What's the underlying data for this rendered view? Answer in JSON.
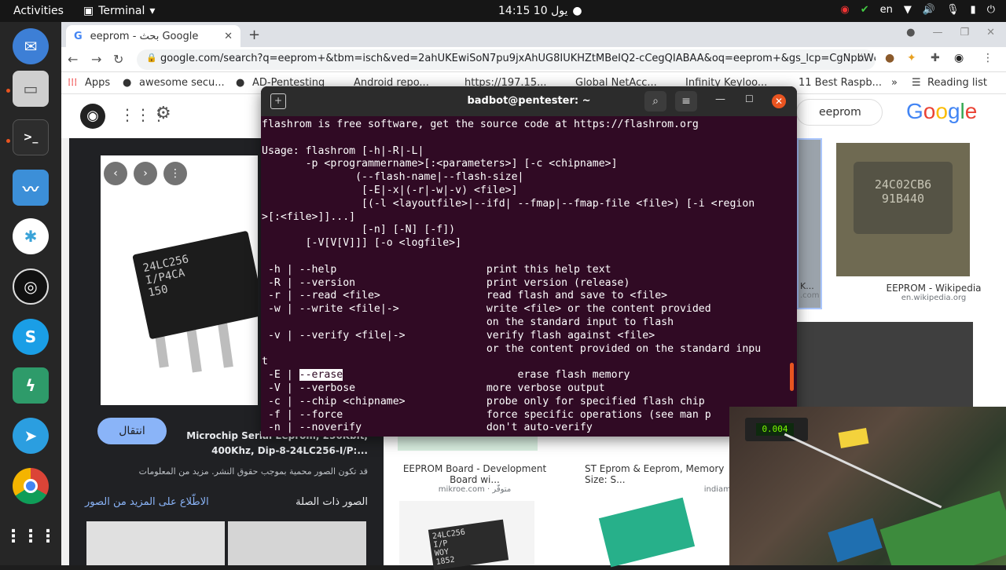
{
  "topbar": {
    "activities": "Activities",
    "app_name": "Terminal",
    "clock": "14:15  يول 10",
    "language": "en"
  },
  "browser": {
    "tab_title": "eeprom - بحث Google",
    "url": "google.com/search?q=eeprom+&tbm=isch&ved=2ahUKEwiSoN7pu9jxAhUG8IUKHZtMBeIQ2-cCegQIABAA&oq=eeprom+&gs_lcp=CgNpbWcQAzIEC...",
    "bookmarks": [
      "Apps",
      "awesome secu...",
      "AD-Pentesting",
      "Android repo...",
      "https://197.15...",
      "Global NetAcc...",
      "Infinity Keyloo...",
      "11 Best Raspb..."
    ],
    "bookmarks_more": "»",
    "reading_list": "Reading list"
  },
  "google": {
    "search_query": "eeprom",
    "logo_letters": [
      "G",
      "o",
      "o",
      "g",
      "l",
      "e"
    ],
    "preview": {
      "visit_button": "انتقال",
      "title_line1": "Microchip Serial Eeprom, 256Kbit,",
      "title_line2": "400Khz, Dip-8-24LC256-I/P:...",
      "copyright": "قد تكون الصور محمية بموجب حقوق النشر. مزيد من المعلومات",
      "see_more": "الاطّلاع على المزيد من الصور",
      "related": "الصور ذات الصلة",
      "chip_label": "24LC256\nI/P4CA\n150"
    },
    "results": [
      {
        "title": "EEPROM - Wikipedia",
        "source": "en.wikipedia.org",
        "chip_text": "24C02CB6\n91B440"
      },
      {
        "title": "EEPROM Board - Development Board wi...",
        "source": "mikroe.com · متوفّر"
      },
      {
        "title": "ST Eprom & Eeprom, Memory Size: S...",
        "source": "indiamart"
      },
      {
        "title": "K...",
        "source": ".com"
      }
    ],
    "bottom_chip_label": "24LC256\nI/P\nWOY\n1852"
  },
  "terminal": {
    "title": "badbot@pentester: ~",
    "lines_before": "flashrom is free software, get the source code at https://flashrom.org\n\nUsage: flashrom [-h|-R|-L|\n       -p <programmername>[:<parameters>] [-c <chipname>]\n               (--flash-name|--flash-size|\n                [-E|-x|(-r|-w|-v) <file>]\n                [(-l <layoutfile>|--ifd| --fmap|--fmap-file <file>) [-i <region\n>[:<file>]]...]\n                [-n] [-N] [-f])\n       [-V[V[V]]] [-o <logfile>]\n\n -h | --help                        print this help text\n -R | --version                     print version (release)\n -r | --read <file>                 read flash and save to <file>\n -w | --write <file|->              write <file> or the content provided\n                                    on the standard input to flash\n -v | --verify <file|->             verify flash against <file>\n                                    or the content provided on the standard inpu\nt\n",
    "erase_prefix": " -E | ",
    "erase_highlight": "--erase",
    "erase_suffix": "                            erase flash memory",
    "lines_after": "\n -V | --verbose                     more verbose output\n -c | --chip <chipname>             probe only for specified flash chip\n -f | --force                       force specific operations (see man p\n -n | --noverify                    don't auto-verify"
  },
  "webcam": {
    "lcd": "0.004"
  }
}
